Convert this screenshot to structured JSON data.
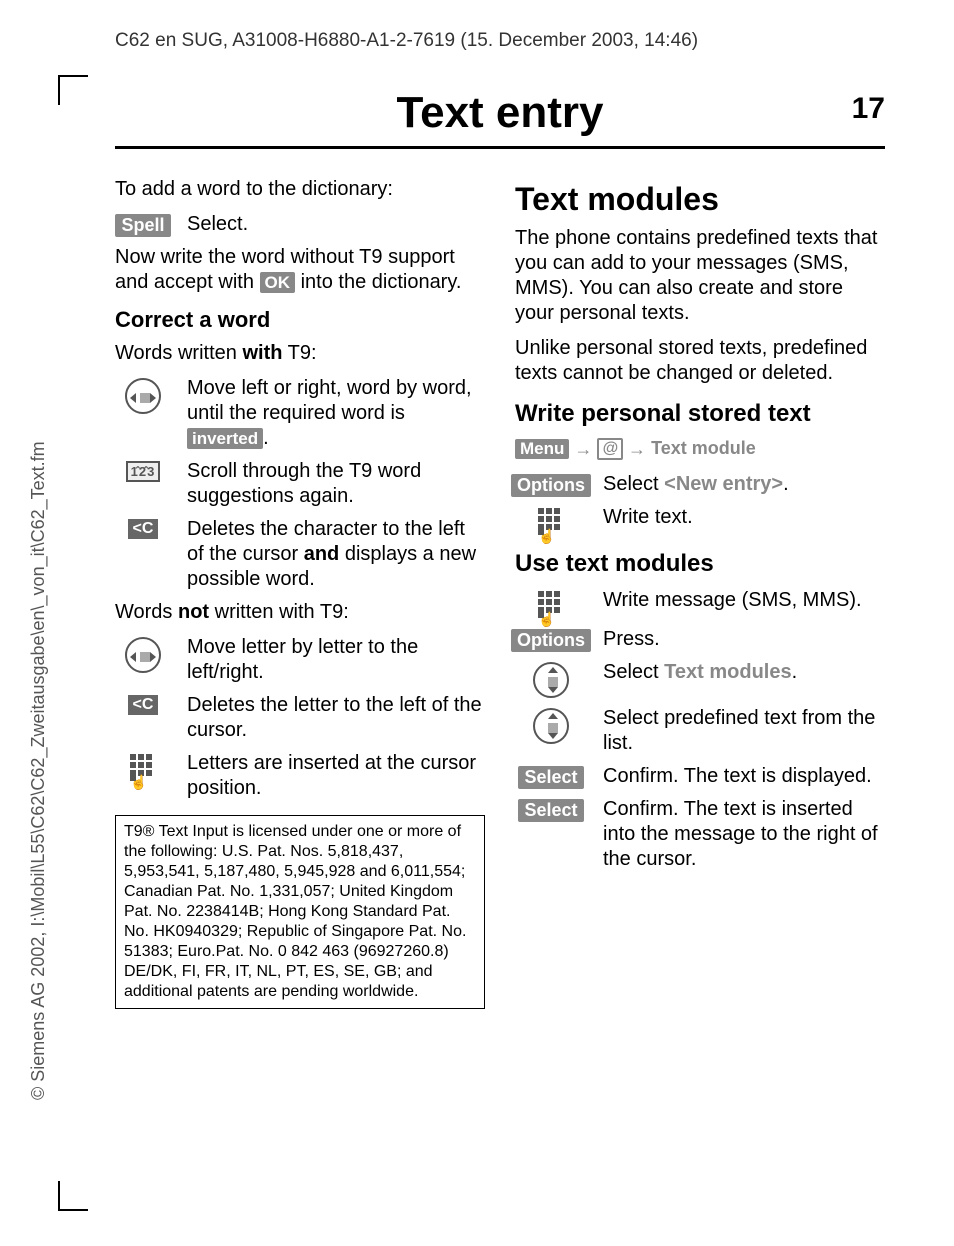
{
  "sideways": "© Siemens AG 2002, I:\\Mobil\\L55\\C62\\C62_Zweitausgabe\\en\\_von_it\\C62_Text.fm",
  "headerPath": "C62 en SUG, A31008-H6880-A1-2-7619 (15. December 2003, 14:46)",
  "title": "Text entry",
  "pageNum": "17",
  "left": {
    "intro": "To add a word to the dictionary:",
    "spellKey": "Spell",
    "spellAction": "Select.",
    "paraWrite1": "Now write the word without T9 support and accept with ",
    "okKey": "OK",
    "paraWrite2": " into the dictionary.",
    "correctHeading": "Correct a word",
    "withT9a": "Words written ",
    "withT9b": "with",
    "withT9c": " T9:",
    "navMove1": "Move left or right, word by word, until the required word is ",
    "invertedKey": "inverted",
    "navMove2": ".",
    "scroll": "Scroll through the T9 word suggestions again.",
    "delChar1": "Deletes the character to the left of the cursor ",
    "delCharBold": "and",
    "delChar2": " displays a new possible word.",
    "notT9a": "Words ",
    "notT9b": "not",
    "notT9c": " written with T9:",
    "moveLetter": "Move letter by letter to the left/right.",
    "delLetter": "Deletes the letter to the left of the cursor.",
    "insertLetter": "Letters are inserted at the cursor position.",
    "patent": "T9® Text Input is licensed under one or more of the following: U.S. Pat. Nos. 5,818,437, 5,953,541, 5,187,480, 5,945,928 and 6,011,554; Canadian Pat. No. 1,331,057; United Kingdom Pat. No. 2238414B;\nHong Kong Standard Pat. No. HK0940329; Republic of Singapore Pat. No. 51383; Euro.Pat. No. 0 842 463 (96927260.8) DE/DK, FI, FR, IT, NL, PT, ES, SE, GB;\nand additional patents are pending worldwide."
  },
  "right": {
    "h2": "Text modules",
    "p1": "The phone contains predefined texts that you can add to your messages (SMS, MMS). You can also create and store your personal texts.",
    "p2": "Unlike personal stored texts, predefined texts cannot be changed or deleted.",
    "h3a": "Write personal stored text",
    "menuKey": "Menu",
    "arrow": "→",
    "textModuleGray": "Text module",
    "optionsKey": "Options",
    "selectNew1": "Select ",
    "newEntryGray": "<New entry>",
    "selectNew2": ".",
    "writeText": "Write text.",
    "h3b": "Use text modules",
    "writeMsg": "Write message (SMS, MMS).",
    "press": "Press.",
    "selectTM1": "Select ",
    "textModulesGray": "Text modules",
    "selectTM2": ".",
    "selectPredef": "Select predefined text from the list.",
    "selectKey": "Select",
    "confirmDisp": "Confirm. The text is displayed.",
    "confirmInsert": "Confirm. The text is inserted into the message to the right of the cursor."
  }
}
